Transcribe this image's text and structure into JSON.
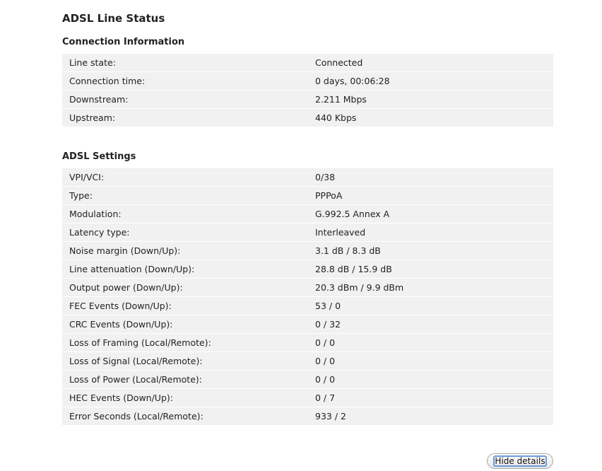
{
  "page": {
    "title": "ADSL Line Status"
  },
  "connection": {
    "title": "Connection Information",
    "rows": [
      {
        "label": "Line state:",
        "value": "Connected"
      },
      {
        "label": "Connection time:",
        "value": "0 days, 00:06:28"
      },
      {
        "label": "Downstream:",
        "value": "2.211 Mbps"
      },
      {
        "label": "Upstream:",
        "value": "440 Kbps"
      }
    ]
  },
  "adsl": {
    "title": "ADSL Settings",
    "rows": [
      {
        "label": "VPI/VCI:",
        "value": "0/38"
      },
      {
        "label": "Type:",
        "value": "PPPoA"
      },
      {
        "label": "Modulation:",
        "value": "G.992.5 Annex A"
      },
      {
        "label": "Latency type:",
        "value": "Interleaved"
      },
      {
        "label": "Noise margin (Down/Up):",
        "value": "3.1 dB / 8.3 dB"
      },
      {
        "label": "Line attenuation (Down/Up):",
        "value": "28.8 dB / 15.9 dB"
      },
      {
        "label": "Output power (Down/Up):",
        "value": "20.3 dBm / 9.9 dBm"
      },
      {
        "label": "FEC Events (Down/Up):",
        "value": "53 / 0"
      },
      {
        "label": "CRC Events (Down/Up):",
        "value": "0 / 32"
      },
      {
        "label": "Loss of Framing (Local/Remote):",
        "value": "0 / 0"
      },
      {
        "label": "Loss of Signal (Local/Remote):",
        "value": "0 / 0"
      },
      {
        "label": "Loss of Power (Local/Remote):",
        "value": "0 / 0"
      },
      {
        "label": "HEC Events (Down/Up):",
        "value": "0 / 7"
      },
      {
        "label": "Error Seconds (Local/Remote):",
        "value": "933 / 2"
      }
    ]
  },
  "actions": {
    "hide_details_label": "Hide details"
  }
}
